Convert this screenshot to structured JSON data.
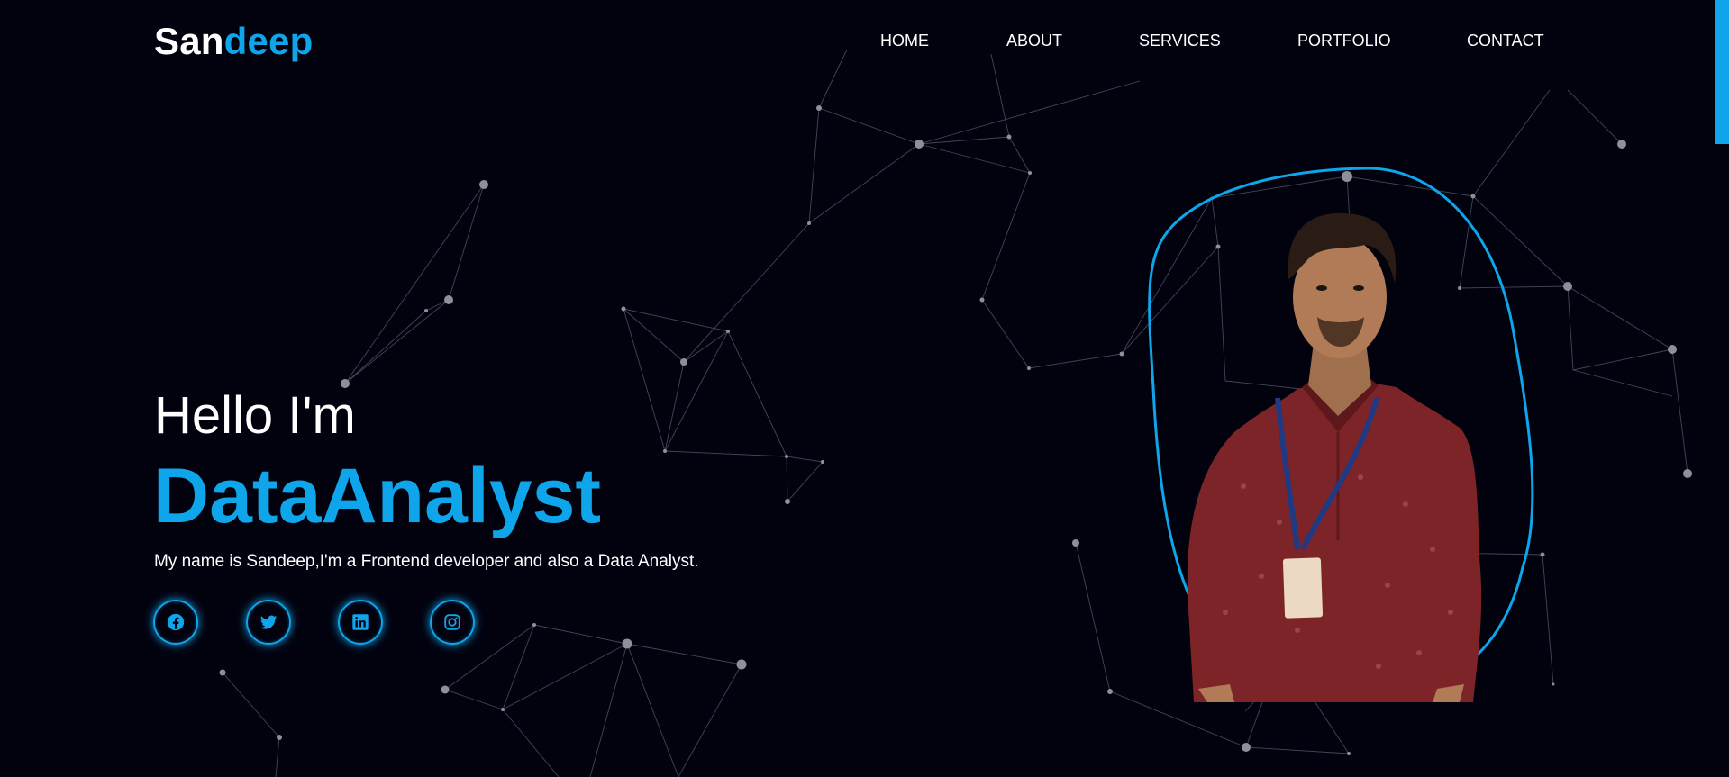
{
  "brand": {
    "first": "San",
    "second": "deep"
  },
  "nav": [
    "HOME",
    "ABOUT",
    "SERVICES",
    "PORTFOLIO",
    "CONTACT"
  ],
  "hero": {
    "greeting": "Hello I'm",
    "role": "DataAnalyst",
    "intro": "My name is Sandeep,I'm a Frontend developer and also a Data Analyst."
  },
  "social": [
    {
      "icon": "facebook-icon"
    },
    {
      "icon": "twitter-icon"
    },
    {
      "icon": "linkedin-icon"
    },
    {
      "icon": "instagram-icon"
    }
  ],
  "colors": {
    "background": "#02020f",
    "accent": "#0ea5ea",
    "shirt": "#7d2428"
  }
}
